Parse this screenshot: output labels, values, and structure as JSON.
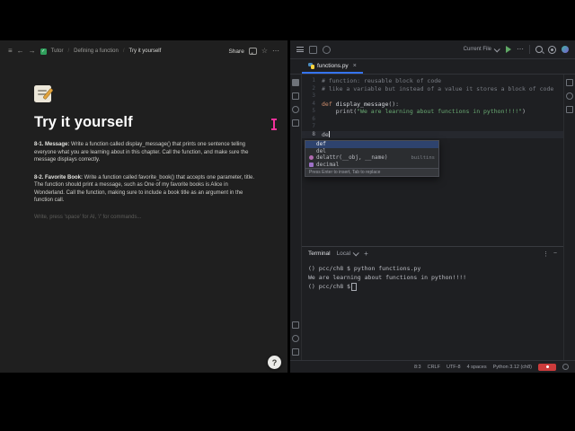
{
  "icons": {
    "back": "←",
    "forward": "→",
    "check": "✓",
    "star": "☆",
    "more": "⋯",
    "slash": "/",
    "close": "×",
    "plus": "+",
    "more_vert": "⋮",
    "minimize": "−"
  },
  "notion": {
    "toolbar": {
      "workspace": "Tutor",
      "parent": "Defining a function",
      "current": "Try it yourself",
      "share_label": "Share"
    },
    "page": {
      "icon": "📝",
      "title": "Try it yourself",
      "para1_lead": "8-1. Message:",
      "para1_body": " Write a function called display_message() that prints one sentence telling everyone what you are learning about in this chapter. Call the function, and make sure the message displays correctly.",
      "para2_lead": "8-2. Favorite Book:",
      "para2_body": " Write a function called favorite_book() that accepts one parameter, title. The function should print a message, such as One of my favorite books is Alice in Wonderland. Call the function, making sure to include a book title as an argument in the function call.",
      "placeholder": "Write, press 'space' for AI, '/' for commands..."
    },
    "help_glyph": "?"
  },
  "ide": {
    "topbar": {
      "run_config": "Current File"
    },
    "tab": {
      "filename": "functions.py"
    },
    "editor": {
      "lines": [
        {
          "num": "1",
          "segs": [
            [
              "cmt",
              "# function: reusable block of code"
            ]
          ]
        },
        {
          "num": "2",
          "segs": [
            [
              "cmt",
              "# like a variable but instead of a value it stores a block of code"
            ]
          ]
        },
        {
          "num": "3",
          "segs": []
        },
        {
          "num": "4",
          "segs": [
            [
              "kw",
              "def "
            ],
            [
              "fn",
              "display_message"
            ],
            [
              "txt",
              "():"
            ]
          ]
        },
        {
          "num": "5",
          "segs": [
            [
              "txt",
              "    print("
            ],
            [
              "str",
              "\"We are learning about functions in python!!!!\""
            ],
            [
              "txt",
              ")"
            ]
          ]
        },
        {
          "num": "6",
          "segs": []
        },
        {
          "num": "7",
          "segs": []
        },
        {
          "num": "8",
          "segs": [
            [
              "txt",
              "de"
            ]
          ],
          "caret": true,
          "current": true
        }
      ]
    },
    "completion": {
      "items": [
        {
          "label": "def",
          "kind": "keyword",
          "selected": true
        },
        {
          "label": "del",
          "kind": "keyword"
        },
        {
          "label": "delattr(__obj, __name)",
          "kind": "function",
          "right": "builtins"
        },
        {
          "label": "decimal",
          "kind": "package"
        }
      ],
      "hint": "Press Enter to insert, Tab to replace"
    },
    "terminal": {
      "title": "Terminal",
      "tab_label": "Local",
      "lines": [
        {
          "segs": [
            [
              "prompt",
              "() pcc/ch8 $ "
            ],
            [
              "cmd",
              "python functions.py"
            ]
          ]
        },
        {
          "segs": [
            [
              "out",
              "We are learning about functions in python!!!!"
            ]
          ]
        },
        {
          "segs": [
            [
              "prompt",
              "() pcc/ch8 $"
            ]
          ],
          "cursor": true
        }
      ]
    },
    "statusbar": {
      "items": [
        "8:3",
        "CRLF",
        "UTF-8",
        "4 spaces",
        "Python 3.12 (ch8)"
      ]
    }
  }
}
